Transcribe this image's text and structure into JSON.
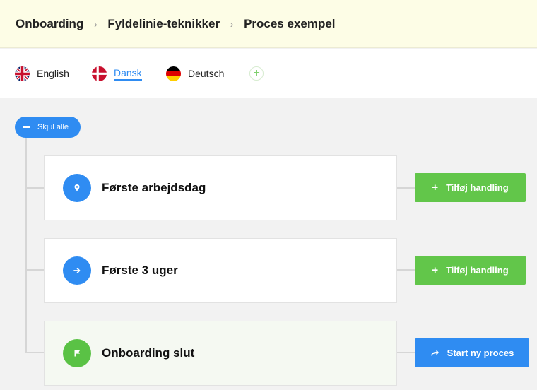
{
  "breadcrumb": {
    "items": [
      "Onboarding",
      "Fyldelinie-teknikker",
      "Proces exempel"
    ],
    "separator": "›"
  },
  "languages": {
    "items": [
      {
        "label": "English",
        "flag": "uk-flag-icon",
        "active": false
      },
      {
        "label": "Dansk",
        "flag": "denmark-flag-icon",
        "active": true
      },
      {
        "label": "Deutsch",
        "flag": "germany-flag-icon",
        "active": false
      }
    ],
    "add_icon": "+"
  },
  "tree": {
    "collapse_label": "Skjul alle",
    "steps": [
      {
        "title": "Første arbejdsdag",
        "icon": "location-pin-icon",
        "action_label": "Tilføj handling",
        "action_icon": "+"
      },
      {
        "title": "Første 3 uger",
        "icon": "arrow-right-icon",
        "action_label": "Tilføj handling",
        "action_icon": "+"
      },
      {
        "title": "Onboarding slut",
        "icon": "flag-icon",
        "action_label": "Start ny proces",
        "action_icon": "➦"
      }
    ]
  },
  "colors": {
    "accent_blue": "#2f8cf2",
    "accent_green": "#62c64a",
    "breadcrumb_bg": "#fdfde6",
    "page_bg": "#f2f2f2"
  }
}
